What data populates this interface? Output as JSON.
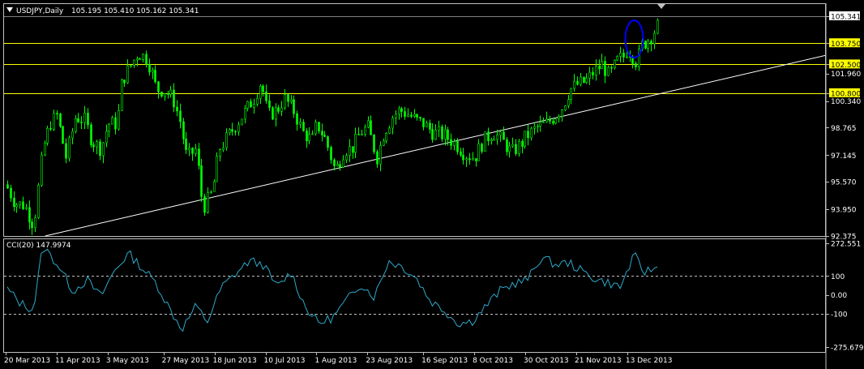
{
  "header": {
    "symbol_label": "USDJPY,Daily",
    "ohlc": "105.195 105.410 105.162 105.341",
    "menu_icon": "triangle-down-icon"
  },
  "colors": {
    "background": "#000000",
    "candle": "#00ff00",
    "hline": "#ffff00",
    "trendline": "#ffffff",
    "cci": "#2fa8c8",
    "ellipse": "#0000ff",
    "label_bg": "#ffff00"
  },
  "price_axis": {
    "ticks": [
      "105.341",
      "103.750",
      "102.500",
      "101.960",
      "100.800",
      "100.340",
      "98.765",
      "97.145",
      "95.570",
      "93.950",
      "92.375"
    ],
    "current_price": "105.341"
  },
  "hlines": [
    {
      "label": "103.750"
    },
    {
      "label": "102.500"
    },
    {
      "label": "100.800"
    }
  ],
  "cci": {
    "label": "CCI(20) 147.9974",
    "ticks": [
      "272.551",
      "100",
      "0.00",
      "-100",
      "-275.6793"
    ]
  },
  "time_axis": {
    "labels": [
      "20 Mar 2013",
      "11 Apr 2013",
      "3 May 2013",
      "27 May 2013",
      "18 Jun 2013",
      "10 Jul 2013",
      "1 Aug 2013",
      "23 Aug 2013",
      "16 Sep 2013",
      "8 Oct 2013",
      "30 Oct 2013",
      "21 Nov 2013",
      "13 Dec 2013"
    ]
  },
  "chart_data": {
    "type": "candlestick",
    "symbol": "USDJPY",
    "timeframe": "Daily",
    "ylim": [
      92.375,
      105.341
    ],
    "price_path": [
      [
        "20 Mar 2013",
        95.4
      ],
      [
        "24 Mar 2013",
        94.3
      ],
      [
        "28 Mar 2013",
        94.2
      ],
      [
        "1 Apr 2013",
        93.0
      ],
      [
        "5 Apr 2013",
        97.5
      ],
      [
        "8 Apr 2013",
        99.0
      ],
      [
        "11 Apr 2013",
        99.5
      ],
      [
        "15 Apr 2013",
        97.0
      ],
      [
        "19 Apr 2013",
        99.4
      ],
      [
        "23 Apr 2013",
        99.2
      ],
      [
        "26 Apr 2013",
        98.0
      ],
      [
        "30 Apr 2013",
        97.5
      ],
      [
        "3 May 2013",
        99.0
      ],
      [
        "7 May 2013",
        99.0
      ],
      [
        "9 May 2013",
        101.5
      ],
      [
        "13 May 2013",
        102.5
      ],
      [
        "16 May 2013",
        103.2
      ],
      [
        "20 May 2013",
        102.8
      ],
      [
        "22 May 2013",
        102.0
      ],
      [
        "24 May 2013",
        101.0
      ],
      [
        "27 May 2013",
        101.0
      ],
      [
        "31 May 2013",
        100.5
      ],
      [
        "3 Jun 2013",
        99.2
      ],
      [
        "6 Jun 2013",
        97.0
      ],
      [
        "10 Jun 2013",
        97.5
      ],
      [
        "13 Jun 2013",
        94.0
      ],
      [
        "17 Jun 2013",
        95.0
      ],
      [
        "20 Jun 2013",
        97.5
      ],
      [
        "25 Jun 2013",
        98.5
      ],
      [
        "30 Jun 2013",
        99.5
      ],
      [
        "5 Jul 2013",
        100.5
      ],
      [
        "8 Jul 2013",
        101.5
      ],
      [
        "11 Jul 2013",
        99.5
      ],
      [
        "15 Jul 2013",
        99.8
      ],
      [
        "18 Jul 2013",
        100.5
      ],
      [
        "22 Jul 2013",
        99.8
      ],
      [
        "26 Jul 2013",
        98.5
      ],
      [
        "30 Jul 2013",
        98.0
      ],
      [
        "1 Aug 2013",
        99.0
      ],
      [
        "5 Aug 2013",
        98.0
      ],
      [
        "9 Aug 2013",
        96.2
      ],
      [
        "13 Aug 2013",
        97.5
      ],
      [
        "16 Aug 2013",
        97.5
      ],
      [
        "20 Aug 2013",
        98.5
      ],
      [
        "23 Aug 2013",
        98.8
      ],
      [
        "27 Aug 2013",
        97.0
      ],
      [
        "30 Aug 2013",
        98.5
      ],
      [
        "3 Sep 2013",
        99.5
      ],
      [
        "6 Sep 2013",
        99.8
      ],
      [
        "10 Sep 2013",
        99.5
      ],
      [
        "13 Sep 2013",
        99.2
      ],
      [
        "16 Sep 2013",
        99.0
      ],
      [
        "20 Sep 2013",
        98.5
      ],
      [
        "25 Sep 2013",
        98.3
      ],
      [
        "30 Sep 2013",
        97.8
      ],
      [
        "4 Oct 2013",
        97.2
      ],
      [
        "8 Oct 2013",
        97.0
      ],
      [
        "12 Oct 2013",
        98.0
      ],
      [
        "16 Oct 2013",
        98.5
      ],
      [
        "20 Oct 2013",
        98.0
      ],
      [
        "24 Oct 2013",
        97.3
      ],
      [
        "28 Oct 2013",
        97.8
      ],
      [
        "30 Oct 2013",
        98.2
      ],
      [
        "4 Nov 2013",
        98.8
      ],
      [
        "8 Nov 2013",
        99.0
      ],
      [
        "12 Nov 2013",
        99.5
      ],
      [
        "15 Nov 2013",
        100.0
      ],
      [
        "18 Nov 2013",
        101.0
      ],
      [
        "21 Nov 2013",
        101.3
      ],
      [
        "25 Nov 2013",
        101.5
      ],
      [
        "28 Nov 2013",
        102.0
      ],
      [
        "2 Dec 2013",
        102.5
      ],
      [
        "5 Dec 2013",
        101.8
      ],
      [
        "9 Dec 2013",
        102.8
      ],
      [
        "12 Dec 2013",
        103.0
      ],
      [
        "13 Dec 2013",
        103.5
      ],
      [
        "17 Dec 2013",
        102.6
      ],
      [
        "19 Dec 2013",
        103.6
      ],
      [
        "23 Dec 2013",
        104.1
      ],
      [
        "26 Dec 2013",
        104.8
      ],
      [
        "27 Dec 2013",
        105.341
      ]
    ],
    "horizontal_levels": [
      103.75,
      102.5,
      100.8
    ],
    "trendline": [
      [
        "6 Apr 2013",
        92.375
      ],
      [
        "28 Dec 2013",
        100.8
      ]
    ],
    "annotation": {
      "type": "ellipse",
      "color": "blue",
      "date": "16 Dec 2013",
      "price_range": [
        102.9,
        105.1
      ]
    },
    "cci_ylim": [
      -275.6793,
      272.551
    ],
    "cci_levels": [
      100,
      0,
      -100
    ],
    "cci_series": [
      [
        "20 Mar 2013",
        40
      ],
      [
        "26 Mar 2013",
        -40
      ],
      [
        "1 Apr 2013",
        -80
      ],
      [
        "5 Apr 2013",
        260
      ],
      [
        "12 Apr 2013",
        150
      ],
      [
        "18 Apr 2013",
        20
      ],
      [
        "24 Apr 2013",
        80
      ],
      [
        "30 Apr 2013",
        -10
      ],
      [
        "6 May 2013",
        130
      ],
      [
        "12 May 2013",
        220
      ],
      [
        "18 May 2013",
        140
      ],
      [
        "24 May 2013",
        60
      ],
      [
        "30 May 2013",
        -80
      ],
      [
        "4 Jun 2013",
        -180
      ],
      [
        "10 Jun 2013",
        -60
      ],
      [
        "15 Jun 2013",
        -140
      ],
      [
        "21 Jun 2013",
        40
      ],
      [
        "27 Jun 2013",
        110
      ],
      [
        "3 Jul 2013",
        180
      ],
      [
        "9 Jul 2013",
        160
      ],
      [
        "15 Jul 2013",
        40
      ],
      [
        "21 Jul 2013",
        120
      ],
      [
        "27 Jul 2013",
        -60
      ],
      [
        "2 Aug 2013",
        -150
      ],
      [
        "8 Aug 2013",
        -120
      ],
      [
        "14 Aug 2013",
        -30
      ],
      [
        "20 Aug 2013",
        60
      ],
      [
        "26 Aug 2013",
        -10
      ],
      [
        "1 Sep 2013",
        180
      ],
      [
        "7 Sep 2013",
        150
      ],
      [
        "13 Sep 2013",
        90
      ],
      [
        "19 Sep 2013",
        -30
      ],
      [
        "25 Sep 2013",
        -80
      ],
      [
        "1 Oct 2013",
        -150
      ],
      [
        "7 Oct 2013",
        -140
      ],
      [
        "13 Oct 2013",
        -60
      ],
      [
        "19 Oct 2013",
        20
      ],
      [
        "25 Oct 2013",
        60
      ],
      [
        "31 Oct 2013",
        80
      ],
      [
        "6 Nov 2013",
        200
      ],
      [
        "12 Nov 2013",
        160
      ],
      [
        "18 Nov 2013",
        170
      ],
      [
        "24 Nov 2013",
        120
      ],
      [
        "30 Nov 2013",
        80
      ],
      [
        "6 Dec 2013",
        60
      ],
      [
        "10 Dec 2013",
        40
      ],
      [
        "16 Dec 2013",
        210
      ],
      [
        "20 Dec 2013",
        120
      ],
      [
        "27 Dec 2013",
        148
      ]
    ]
  }
}
